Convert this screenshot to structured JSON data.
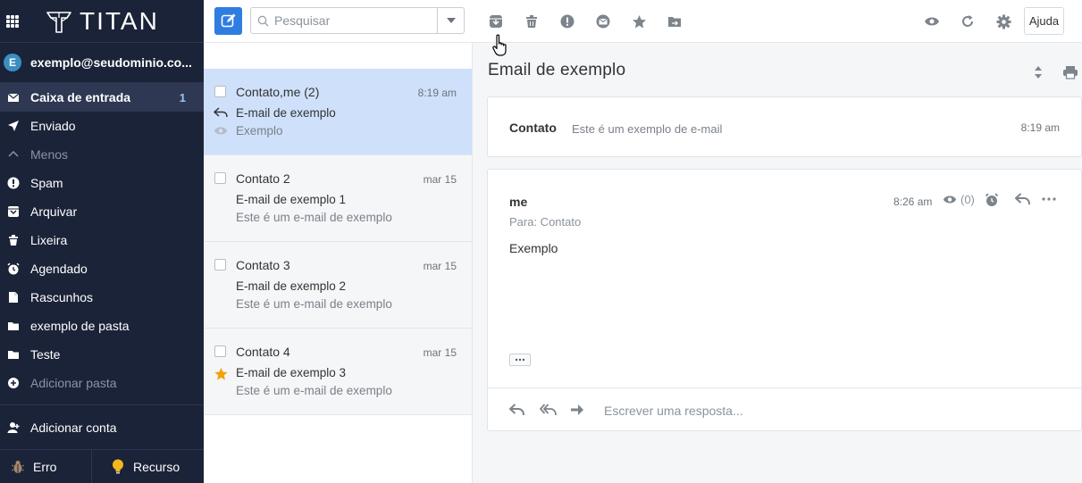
{
  "app": {
    "brand": "TITAN"
  },
  "sidebar": {
    "account_initial": "E",
    "account_email": "exemplo@seudominio.co...",
    "folders": [
      {
        "label": "Caixa de entrada",
        "count": "1",
        "icon": "inbox-icon"
      },
      {
        "label": "Enviado",
        "icon": "send-icon"
      },
      {
        "label": "Menos",
        "icon": "chevron-up-icon"
      },
      {
        "label": "Spam",
        "icon": "alert-circle-icon"
      },
      {
        "label": "Arquivar",
        "icon": "archive-icon"
      },
      {
        "label": "Lixeira",
        "icon": "trash-icon"
      },
      {
        "label": "Agendado",
        "icon": "alarm-clock-icon"
      },
      {
        "label": "Rascunhos",
        "icon": "draft-icon"
      },
      {
        "label": "exemplo de pasta",
        "icon": "folder-icon"
      },
      {
        "label": "Teste",
        "icon": "folder-icon"
      },
      {
        "label": "Adicionar pasta",
        "icon": "plus-circle-icon"
      }
    ],
    "add_account": "Adicionar conta",
    "bug_label": "Erro",
    "feature_label": "Recurso"
  },
  "toolbar": {
    "search_placeholder": "Pesquisar",
    "help_label": "Ajuda",
    "actions": [
      "archive-icon",
      "trash-icon",
      "spam-icon",
      "mark-unread-icon",
      "star-icon",
      "move-to-folder-icon"
    ],
    "right_actions": [
      "eye-icon",
      "refresh-icon",
      "gear-icon"
    ]
  },
  "messages": [
    {
      "sender": "Contato,me (2)",
      "time": "8:19 am",
      "subject": "E-mail de exemplo",
      "preview": "Exemplo",
      "selected": true,
      "replied": true,
      "read_receipt": true
    },
    {
      "sender": "Contato 2",
      "time": "mar 15",
      "subject": "E-mail de exemplo 1",
      "preview": "Este é um e-mail de exemplo"
    },
    {
      "sender": "Contato 3",
      "time": "mar 15",
      "subject": "E-mail de exemplo 2",
      "preview": "Este é um e-mail de exemplo"
    },
    {
      "sender": "Contato 4",
      "time": "mar 15",
      "subject": "E-mail de exemplo 3",
      "preview": "Este é um e-mail de exemplo",
      "starred": true
    }
  ],
  "reading": {
    "title": "Email de exemplo",
    "collapsed": {
      "from": "Contato",
      "snippet": "Este é um exemplo de e-mail",
      "time": "8:19 am"
    },
    "expanded": {
      "from": "me",
      "to": "Para: Contato",
      "time": "8:26 am",
      "views": "(0)",
      "body": "Exemplo",
      "ellipsis": "..."
    },
    "reply_placeholder": "Escrever uma resposta..."
  },
  "colors": {
    "sidebar_bg": "#1b2338",
    "accent": "#2f7de1",
    "selected_row": "#cfe0fb",
    "star": "#f0a30a"
  }
}
